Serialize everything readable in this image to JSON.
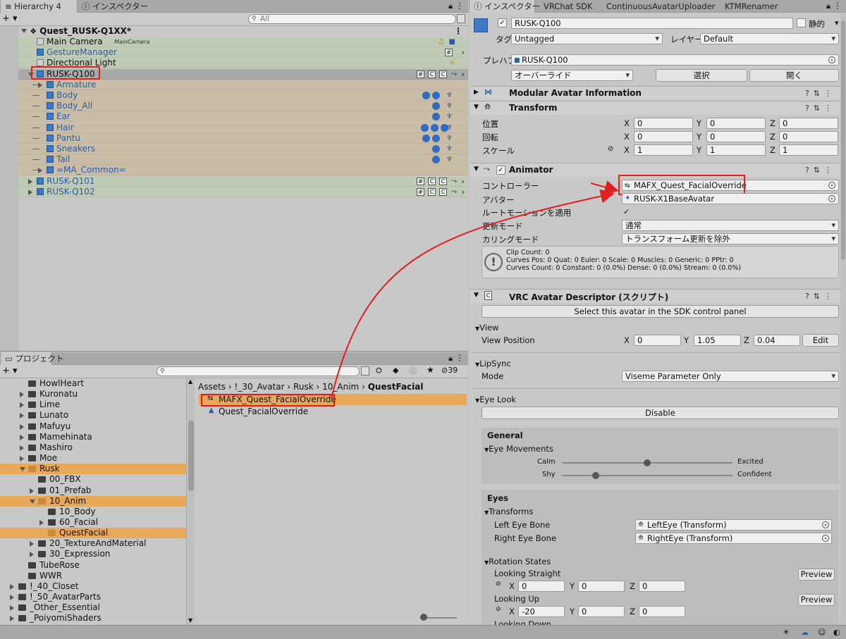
{
  "hierarchy": {
    "tabs": [
      "Hierarchy 4",
      "インスペクター"
    ],
    "plus": "+ ▾",
    "search_placeholder": "All",
    "scene": "Quest_RUSK-Q1XX*",
    "items": [
      {
        "label": "Main Camera",
        "tag": "MainCamera",
        "indent": 1,
        "kind": "gray",
        "bg": "#bfcbb5"
      },
      {
        "label": "GestureManager",
        "indent": 1,
        "kind": "blue-text",
        "bg": "#bfcbb5"
      },
      {
        "label": "Directional Light",
        "indent": 1,
        "kind": "gray",
        "bg": "#bfcbb5"
      },
      {
        "label": "RUSK-Q100",
        "indent": 1,
        "kind": "selected",
        "bg": "#a9a9a9"
      },
      {
        "label": "Armature",
        "indent": 2,
        "kind": "blue",
        "bg": "#c9bda8"
      },
      {
        "label": "Body",
        "indent": 2,
        "kind": "blue",
        "bg": "#c9bda8"
      },
      {
        "label": "Body_All",
        "indent": 2,
        "kind": "blue",
        "bg": "#c9bda8"
      },
      {
        "label": "Ear",
        "indent": 2,
        "kind": "blue",
        "bg": "#c9bda8"
      },
      {
        "label": "Hair",
        "indent": 2,
        "kind": "blue",
        "bg": "#c9bda8"
      },
      {
        "label": "Pantu",
        "indent": 2,
        "kind": "blue",
        "bg": "#c9bda8"
      },
      {
        "label": "Sneakers",
        "indent": 2,
        "kind": "blue",
        "bg": "#c9bda8"
      },
      {
        "label": "Tail",
        "indent": 2,
        "kind": "blue",
        "bg": "#c9bda8"
      },
      {
        "label": "=MA_Common=",
        "indent": 2,
        "kind": "blue",
        "bg": "#c9bda8"
      },
      {
        "label": "RUSK-Q101",
        "indent": 1,
        "kind": "blue-text",
        "bg": "#bfcbb5"
      },
      {
        "label": "RUSK-Q102",
        "indent": 1,
        "kind": "blue-text",
        "bg": "#bfcbb5"
      }
    ]
  },
  "project": {
    "tab": "プロジェクト",
    "plus": "+ ▾",
    "hidden_count": "39",
    "breadcrumb": [
      "Assets",
      "!_30_Avatar",
      "Rusk",
      "10_Anim",
      "QuestFacial"
    ],
    "tree": [
      {
        "label": "HowlHeart",
        "depth": 2
      },
      {
        "label": "Kuronatu",
        "depth": 2
      },
      {
        "label": "Lime",
        "depth": 2
      },
      {
        "label": "Lunato",
        "depth": 2
      },
      {
        "label": "Mafuyu",
        "depth": 2
      },
      {
        "label": "Mamehinata",
        "depth": 2
      },
      {
        "label": "Mashiro",
        "depth": 2
      },
      {
        "label": "Moe",
        "depth": 2
      },
      {
        "label": "Rusk",
        "depth": 2,
        "open": true
      },
      {
        "label": "00_FBX",
        "depth": 3
      },
      {
        "label": "01_Prefab",
        "depth": 3
      },
      {
        "label": "10_Anim",
        "depth": 3,
        "open": true
      },
      {
        "label": "10_Body",
        "depth": 4
      },
      {
        "label": "60_Facial",
        "depth": 4
      },
      {
        "label": "QuestFacial",
        "depth": 4,
        "selected": true
      },
      {
        "label": "20_TextureAndMaterial",
        "depth": 3
      },
      {
        "label": "30_Expression",
        "depth": 3
      },
      {
        "label": "TubeRose",
        "depth": 2
      },
      {
        "label": "WWR",
        "depth": 2
      },
      {
        "label": "!_40_Closet",
        "depth": 1
      },
      {
        "label": "!_50_AvatarParts",
        "depth": 1
      },
      {
        "label": "_Other_Essential",
        "depth": 1
      },
      {
        "label": "_PoiyomiShaders",
        "depth": 1
      }
    ],
    "assets": [
      "MAFX_Quest_FacialOverride",
      "Quest_FacialOverride"
    ]
  },
  "inspector": {
    "tabs": [
      "インスペクター",
      "VRChat SDK",
      "ContinuousAvatarUploader",
      "KTMRenamer"
    ],
    "object_name": "RUSK-Q100",
    "static_label": "静的",
    "tag_label": "タグ",
    "tag_value": "Untagged",
    "layer_label": "レイヤー",
    "layer_value": "Default",
    "prefab_label": "プレハブ",
    "prefab_value": "RUSK-Q100",
    "override_label": "オーバーライド",
    "select_label": "選択",
    "open_label": "開く",
    "components": {
      "modular": "Modular Avatar Information",
      "transform": "Transform",
      "animator": "Animator",
      "vrc": "VRC Avatar Descriptor (スクリプト)"
    },
    "transform": {
      "position_label": "位置",
      "rotation_label": "回転",
      "scale_label": "スケール",
      "position": [
        "0",
        "0",
        "0"
      ],
      "rotation": [
        "0",
        "0",
        "0"
      ],
      "scale": [
        "1",
        "1",
        "1"
      ]
    },
    "animator": {
      "controller_label": "コントローラー",
      "controller_value": "MAFX_Quest_FacialOverride",
      "avatar_label": "アバター",
      "avatar_value": "RUSK-X1BaseAvatar",
      "root_motion_label": "ルートモーションを適用",
      "update_mode_label": "更新モード",
      "update_mode_value": "通常",
      "culling_label": "カリングモード",
      "culling_value": "トランスフォーム更新を除外",
      "info_lines": [
        "Clip Count: 0",
        "Curves Pos: 0 Quat: 0 Euler: 0 Scale: 0 Muscles: 0 Generic: 0 PPtr: 0",
        "Curves Count: 0 Constant: 0 (0.0%) Dense: 0 (0.0%) Stream: 0 (0.0%)"
      ]
    },
    "vrc": {
      "select_button": "Select this avatar in the SDK control panel",
      "view_header": "View",
      "view_position_label": "View Position",
      "view_position": [
        "0",
        "1.05",
        "0.04"
      ],
      "edit_label": "Edit",
      "lipsync_header": "LipSync",
      "mode_label": "Mode",
      "mode_value": "Viseme Parameter Only",
      "eyelook_header": "Eye Look",
      "disable_label": "Disable",
      "general_header": "General",
      "eye_movements_label": "Eye Movements",
      "calm_label": "Calm",
      "excited_label": "Excited",
      "shy_label": "Shy",
      "confident_label": "Confident",
      "calm_value": 0.5,
      "shy_value": 0.2,
      "eyes_header": "Eyes",
      "transforms_label": "Transforms",
      "left_eye_label": "Left Eye Bone",
      "left_eye_value": "LeftEye (Transform)",
      "right_eye_label": "Right Eye Bone",
      "right_eye_value": "RightEye (Transform)",
      "rotation_states_label": "Rotation States",
      "looking_straight_label": "Looking Straight",
      "looking_straight": [
        "0",
        "0",
        "0"
      ],
      "looking_up_label": "Looking Up",
      "looking_up": [
        "-20",
        "0",
        "0"
      ],
      "looking_down_label": "Looking Down",
      "preview_label": "Preview"
    }
  },
  "axis": {
    "x": "X",
    "y": "Y",
    "z": "Z"
  },
  "colors": {
    "annotation": "#e0201e",
    "selection": "#e8a85a",
    "blue_text": "#2a5ea8"
  }
}
